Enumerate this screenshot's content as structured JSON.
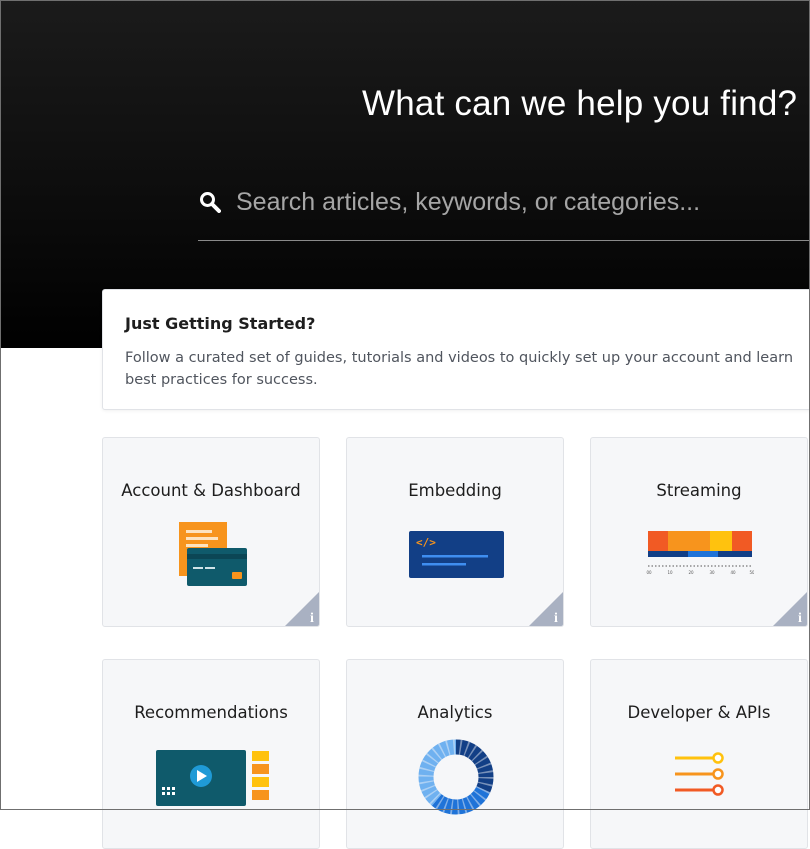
{
  "hero": {
    "title": "What can we help you find?",
    "search_placeholder": "Search articles, keywords, or categories..."
  },
  "getting_started": {
    "title": "Just Getting Started?",
    "description": "Follow a curated set of guides, tutorials and videos to quickly set up your account and learn best practices for success."
  },
  "cards": [
    {
      "label": "Account & Dashboard",
      "icon": "credit-card-icon"
    },
    {
      "label": "Embedding",
      "icon": "code-embed-icon"
    },
    {
      "label": "Streaming",
      "icon": "streaming-timeline-icon"
    },
    {
      "label": "Recommendations",
      "icon": "video-recommendations-icon"
    },
    {
      "label": "Analytics",
      "icon": "donut-chart-icon"
    },
    {
      "label": "Developer & APIs",
      "icon": "api-sliders-icon"
    }
  ],
  "streaming_ticks": [
    "00",
    "10",
    "20",
    "30",
    "40",
    "50"
  ],
  "colors": {
    "orange": "#f7941d",
    "teal": "#0f5a6b",
    "navy": "#123f86",
    "blue": "#1f73d8",
    "info_corner": "#a9b1c2"
  }
}
